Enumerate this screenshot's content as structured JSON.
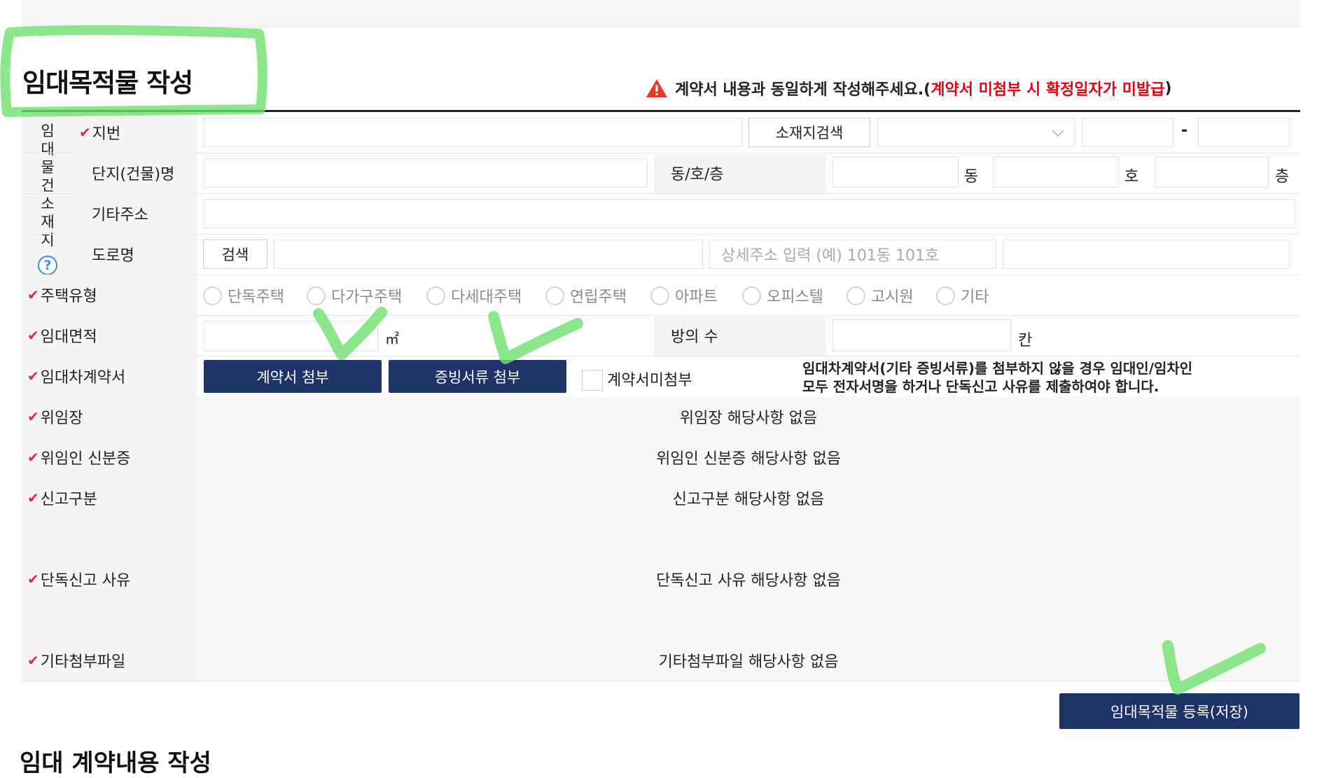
{
  "page_title": "임대목적물 작성",
  "notice": {
    "text": "계약서 내용과 동일하게 작성해주세요.(",
    "red_text": "계약서 미첨부 시 확정일자가 미발급",
    "close": ")"
  },
  "location_group": {
    "chars": [
      "임",
      "대",
      "물",
      "건",
      "소",
      "재",
      "지"
    ],
    "help": "?"
  },
  "rows": {
    "jibeon": {
      "label": "지번",
      "search_button": "소재지검색",
      "dash": "-"
    },
    "complex": {
      "label": "단지(건물)명",
      "dong_ho_label": "동/호/층",
      "unit_dong": "동",
      "unit_ho": "호",
      "unit_floor": "층"
    },
    "other_address": {
      "label": "기타주소"
    },
    "road": {
      "label": "도로명",
      "search_button": "검색",
      "detail_placeholder": "상세주소 입력 (예) 101동 101호"
    },
    "housing_type": {
      "label": "주택유형",
      "options": [
        "단독주택",
        "다가구주택",
        "다세대주택",
        "연립주택",
        "아파트",
        "오피스텔",
        "고시원",
        "기타"
      ]
    },
    "area": {
      "label": "임대면적",
      "unit": "㎡",
      "rooms_label": "방의 수",
      "rooms_unit": "칸"
    },
    "contract": {
      "label": "임대차계약서",
      "attach_contract": "계약서 첨부",
      "attach_evidence": "증빙서류 첨부",
      "no_attach": "계약서미첨부",
      "note_line1": "임대차계약서(기타 증빙서류)를 첨부하지 않을 경우 임대인/임차인",
      "note_line2": "모두 전자서명을 하거나 단독신고 사유를 제출하여야 합니다."
    },
    "power_of_attorney": {
      "label": "위임장",
      "value": "위임장 해당사항 없음"
    },
    "delegator_id": {
      "label": "위임인 신분증",
      "value": "위임인 신분증 해당사항 없음"
    },
    "report_type": {
      "label": "신고구분",
      "value": "신고구분 해당사항 없음"
    },
    "sole_report_reason": {
      "label": "단독신고 사유",
      "value": "단독신고 사유 해당사항 없음"
    },
    "other_attachments": {
      "label": "기타첨부파일",
      "value": "기타첨부파일 해당사항 없음"
    }
  },
  "save_button": "임대목적물 등록(저장)",
  "next_section_title": "임대 계약내용 작성",
  "colors": {
    "navy": "#1e3368",
    "required_check": "#e0245e",
    "warning_red": "#e60012",
    "highlight_green": "#6fe06f"
  }
}
